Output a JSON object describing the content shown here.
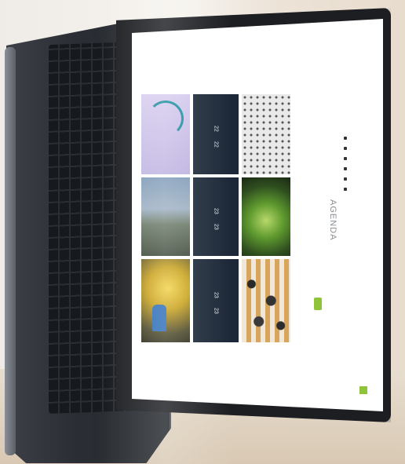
{
  "screen": {
    "agenda_heading": "AGENDA",
    "nav_text": "",
    "tiles": [
      {
        "id": "n1",
        "lines": [
          "",
          "22",
          "",
          "22"
        ]
      },
      {
        "id": "n2",
        "lines": [
          "",
          "23",
          "",
          "23"
        ]
      },
      {
        "id": "n3",
        "lines": [
          "",
          "23",
          "",
          "23"
        ]
      }
    ]
  },
  "colors": {
    "accent_green": "#8fc43a",
    "tile_navy": "#1c2838",
    "laptop_body": "#2b2f35"
  }
}
